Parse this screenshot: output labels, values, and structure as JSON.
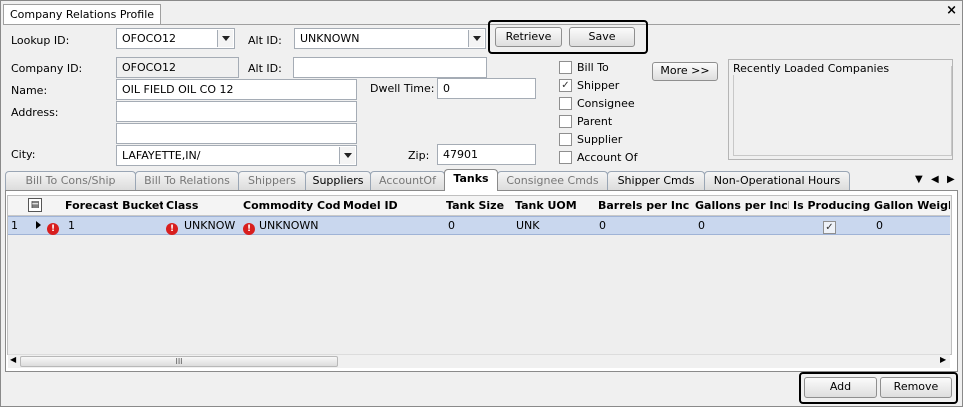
{
  "window": {
    "tab_title": "Company Relations Profile",
    "close_icon": "close-icon"
  },
  "lookup": {
    "lookup_id_label": "Lookup ID:",
    "lookup_id_value": "OFOCO12",
    "alt_id_label": "Alt ID:",
    "alt_id_value": "UNKNOWN",
    "retrieve_label": "Retrieve",
    "save_label": "Save"
  },
  "company": {
    "company_id_label": "Company ID:",
    "company_id_value": "OFOCO12",
    "alt_id_label": "Alt ID:",
    "alt_id_value": "",
    "name_label": "Name:",
    "name_value": "OIL FIELD OIL CO 12",
    "address_label": "Address:",
    "address_line1": "",
    "address_line2": "",
    "city_label": "City:",
    "city_value": "LAFAYETTE,IN/",
    "dwell_time_label": "Dwell Time:",
    "dwell_time_value": "0",
    "zip_label": "Zip:",
    "zip_value": "47901"
  },
  "roles": [
    {
      "label": "Bill To",
      "checked": false
    },
    {
      "label": "Shipper",
      "checked": true
    },
    {
      "label": "Consignee",
      "checked": false
    },
    {
      "label": "Parent",
      "checked": false
    },
    {
      "label": "Supplier",
      "checked": false
    },
    {
      "label": "Account Of",
      "checked": false
    }
  ],
  "more_label": "More >>",
  "recent_title": "Recently Loaded Companies",
  "tabs": [
    {
      "label": "Bill To Cons/Ship",
      "state": "disabled"
    },
    {
      "label": "Bill To Relations",
      "state": "disabled"
    },
    {
      "label": "Shippers",
      "state": "disabled"
    },
    {
      "label": "Suppliers",
      "state": "enabled"
    },
    {
      "label": "AccountOf",
      "state": "disabled"
    },
    {
      "label": "Tanks",
      "state": "active"
    },
    {
      "label": "Consignee Cmds",
      "state": "disabled"
    },
    {
      "label": "Shipper Cmds",
      "state": "enabled"
    },
    {
      "label": "Non-Operational Hours",
      "state": "enabled"
    }
  ],
  "grid": {
    "columns": [
      "Forecast Bucket",
      "Class",
      "Commodity Code",
      "Model ID",
      "Tank Size",
      "Tank UOM",
      "Barrels per Inch",
      "Gallons per Inch",
      "Is Producing",
      "Gallon Weight"
    ],
    "rows": [
      {
        "row_number": "1",
        "forecast_bucket": "1",
        "class": "UNKNOW",
        "commodity_code": "UNKNOWN",
        "model_id": "",
        "tank_size": "0",
        "tank_uom": "UNK",
        "barrels_per_inch": "0",
        "gallons_per_inch": "0",
        "is_producing": true,
        "gallon_weight": "0"
      }
    ],
    "scroll_grip": "III"
  },
  "actions": {
    "add_label": "Add",
    "remove_label": "Remove"
  },
  "colors": {
    "selected_row": "#c9d7ee",
    "error": "#d81e1e",
    "active_tab": "#ffffff"
  }
}
